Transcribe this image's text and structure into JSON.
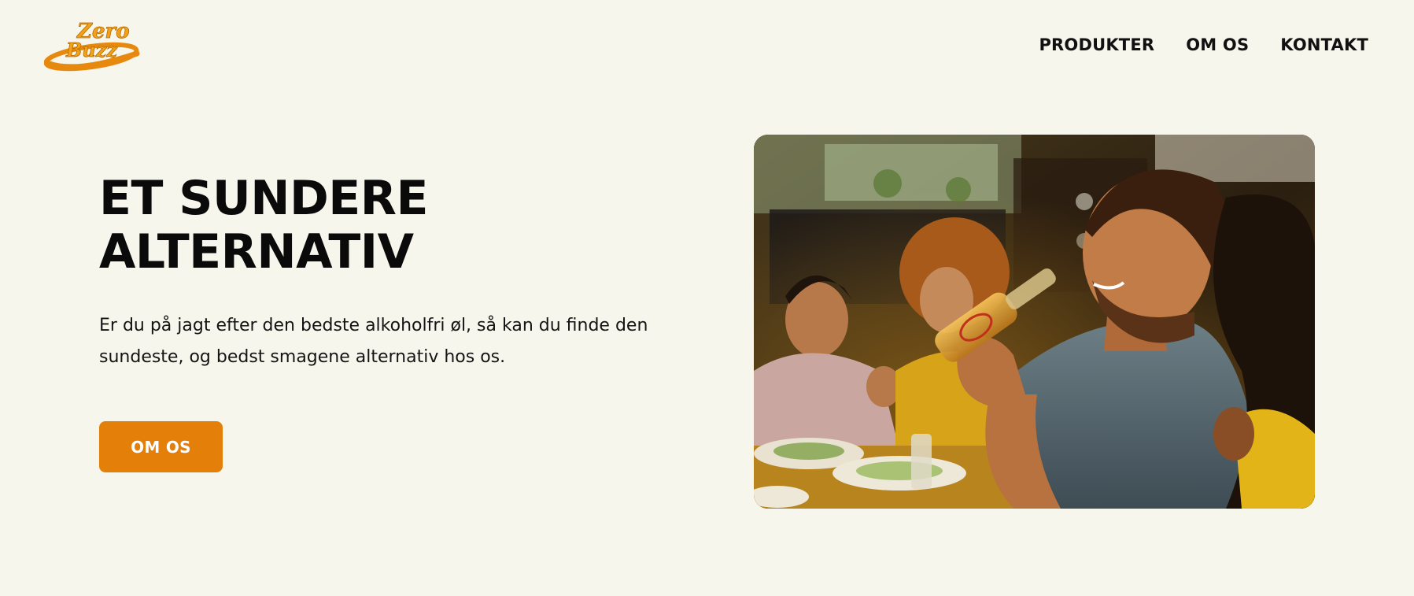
{
  "brand": {
    "logo_line1": "Zero",
    "logo_line2": "Buzz",
    "accent_color": "#e47f0a",
    "background_color": "#f7f6ec"
  },
  "nav": {
    "items": [
      {
        "label": "PRODUKTER"
      },
      {
        "label": "OM OS"
      },
      {
        "label": "KONTAKT"
      }
    ]
  },
  "hero": {
    "title_line1": "ET SUNDERE",
    "title_line2": "ALTERNATIV",
    "text": "Er du på jagt efter den bedste alkoholfri øl, så kan du finde den sundeste, og bedst smagene alternativ hos os.",
    "button_label": "OM OS",
    "image_alt": "Smilende mand drikker alkoholfri øl med venner ved et bord",
    "image_icon": "photo"
  }
}
